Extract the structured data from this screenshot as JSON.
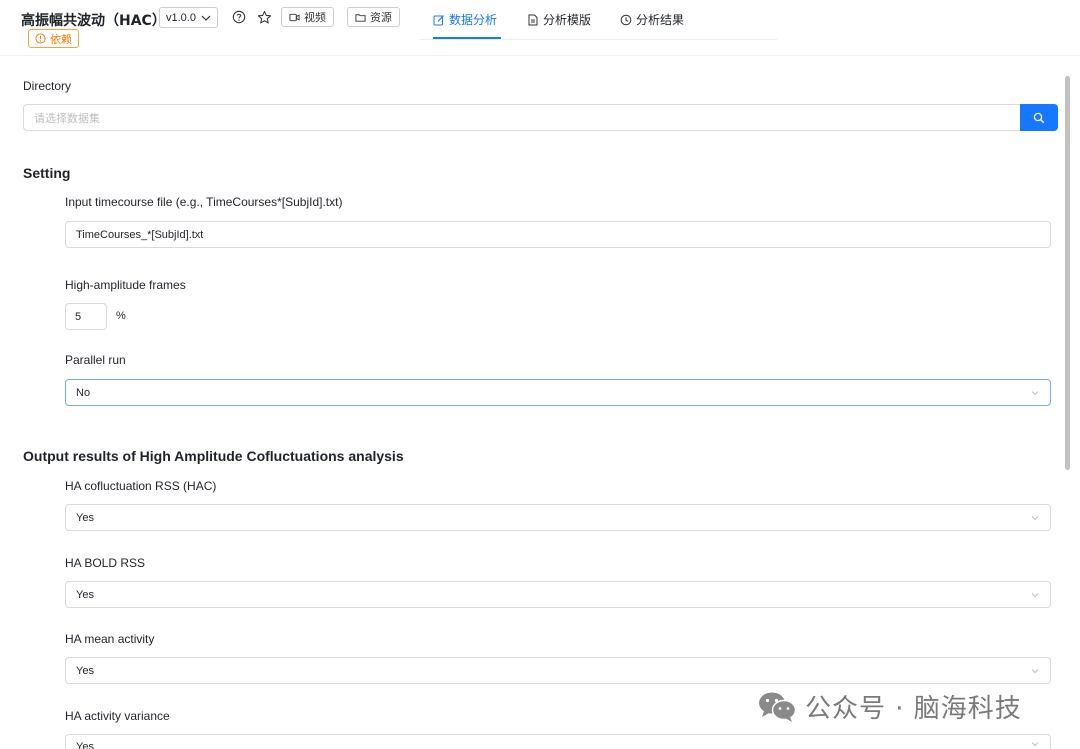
{
  "header": {
    "app_title": "高振幅共波动（HAC）",
    "version": "v1.0.0",
    "video_label": "视频",
    "resource_label": "资源",
    "dependency_label": "依赖",
    "tabs": [
      {
        "label": "数据分析",
        "icon": "edit-icon",
        "active": true
      },
      {
        "label": "分析模版",
        "icon": "document-icon",
        "active": false
      },
      {
        "label": "分析结果",
        "icon": "clock-icon",
        "active": false
      }
    ],
    "accent_color": "#1677ff",
    "dependency_color": "#f57a00"
  },
  "directory": {
    "label": "Directory",
    "placeholder": "请选择数据集"
  },
  "setting": {
    "title": "Setting",
    "timecourse_label": "Input timecourse file (e.g., TimeCourses*[SubjId].txt)",
    "timecourse_value": "TimeCourses_*[SubjId].txt",
    "frames_label": "High-amplitude frames",
    "frames_value": "5",
    "frames_unit": "%",
    "parallel_label": "Parallel run",
    "parallel_value": "No"
  },
  "output": {
    "title": "Output results of High Amplitude Cofluctuations analysis",
    "items": [
      {
        "label": "HA cofluctuation RSS (HAC)",
        "value": "Yes"
      },
      {
        "label": "HA BOLD RSS",
        "value": "Yes"
      },
      {
        "label": "HA mean activity",
        "value": "Yes"
      },
      {
        "label": "HA activity variance",
        "value": "Yes"
      }
    ]
  },
  "watermark": {
    "text": "公众号 · 脑海科技",
    "icon": "wechat-icon"
  }
}
